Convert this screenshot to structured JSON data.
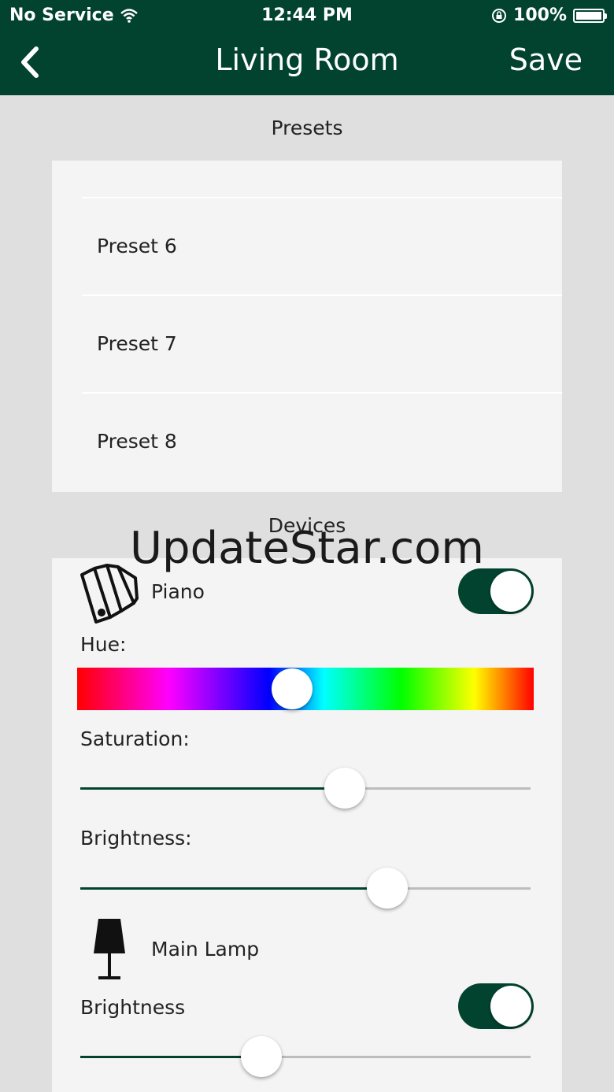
{
  "status_bar": {
    "carrier": "No Service",
    "time": "12:44 PM",
    "battery": "100%"
  },
  "nav": {
    "title": "Living Room",
    "save_label": "Save",
    "back_icon": "chevron-left-icon"
  },
  "presets": {
    "section_label": "Presets",
    "items": [
      "Preset 6",
      "Preset 7",
      "Preset 8"
    ]
  },
  "devices": {
    "section_label": "Devices",
    "items": [
      {
        "name": "Piano",
        "icon": "color-swatch-icon",
        "enabled": true,
        "hue_label": "Hue:",
        "hue_value": 0.47,
        "saturation_label": "Saturation:",
        "saturation_value": 0.59,
        "brightness_label": "Brightness:",
        "brightness_value": 0.68
      },
      {
        "name": "Main Lamp",
        "icon": "table-lamp-icon",
        "enabled": true,
        "brightness_label": "Brightness",
        "brightness_value": 0.4
      }
    ]
  },
  "watermark": "UpdateStar.com",
  "colors": {
    "brand_green": "#024330",
    "card_bg": "#f4f4f4",
    "page_bg": "#dfdfdf"
  }
}
